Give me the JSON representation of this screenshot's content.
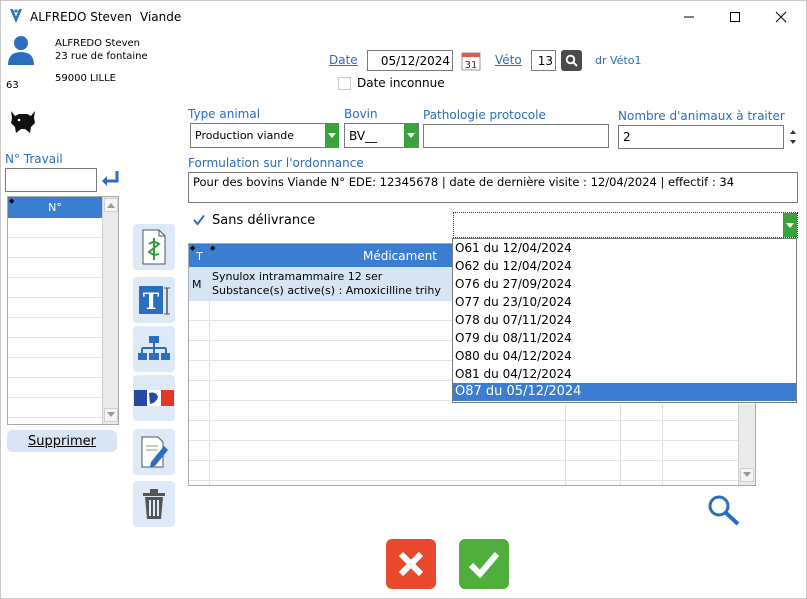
{
  "window": {
    "title_name": "ALFREDO Steven",
    "title_category": "Viande"
  },
  "client": {
    "name": "ALFREDO Steven",
    "address": "23 rue de fontaine",
    "city": "59000 LILLE",
    "number": "63"
  },
  "header": {
    "date_label": "Date",
    "date_value": "05/12/2024",
    "calendar_day": "31",
    "veto_label": "Véto",
    "veto_value": "13",
    "veto_name": "dr Véto1",
    "date_inconnue_label": "Date inconnue"
  },
  "form": {
    "type_animal_label": "Type animal",
    "type_animal_value": "Production viande",
    "bovin_label": "Bovin",
    "bovin_value": "BV__",
    "pathologie_label": "Pathologie protocole",
    "pathologie_value": "",
    "nombre_label": "Nombre d'animaux à traiter",
    "nombre_value": "2",
    "formulation_label": "Formulation sur l'ordonnance",
    "formulation_value": "Pour des bovins Viande N° EDE: 12345678 | date de dernière visite : 12/04/2024 | effectif : 34",
    "sans_delivrance_label": "Sans délivrance",
    "ordonnance_select_value": ""
  },
  "travail": {
    "label": "N° Travail",
    "input_value": "",
    "column_header": "N°",
    "supprimer_label": "Supprimer"
  },
  "medicaments": {
    "col_t": "T",
    "col_medicament": "Médicament",
    "rows": [
      {
        "type": "M",
        "line1": "Synulox intramammaire 12 ser",
        "line2": "Substance(s) active(s) : Amoxicilline trihy"
      }
    ]
  },
  "dropdown": {
    "items": [
      "O61 du 12/04/2024",
      "O62 du 12/04/2024",
      "O76 du 27/09/2024",
      "O77 du 23/10/2024",
      "O78 du 07/11/2024",
      "O79 du 08/11/2024",
      "O80 du 04/12/2024",
      "O81 du 04/12/2024",
      "O87 du 05/12/2024"
    ],
    "selected_index": 8
  },
  "colors": {
    "accent_blue": "#2a6ebd",
    "dropdown_green": "#37a33a",
    "cancel_red": "#e8492c",
    "ok_green": "#4fae3c",
    "selection_blue": "#3b7dd1"
  }
}
